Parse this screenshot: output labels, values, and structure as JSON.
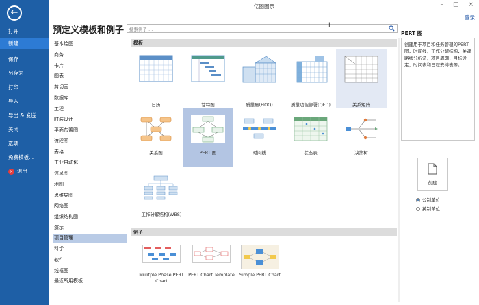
{
  "window": {
    "title": "亿图图示",
    "login": "登录"
  },
  "sidebar": {
    "items": [
      "打开",
      "新建",
      "保存",
      "另存为",
      "打印",
      "导入",
      "导出 & 发送",
      "关闭",
      "选项",
      "免费模板...",
      "退出"
    ]
  },
  "main": {
    "heading": "预定义模板和例子",
    "search_placeholder": "搜索例子 . . ."
  },
  "categories": [
    "基本绘图",
    "商务",
    "卡片",
    "图表",
    "剪切画",
    "数据库",
    "工程",
    "时装设计",
    "平面布置图",
    "流程图",
    "表格",
    "工业自动化",
    "信息图",
    "地图",
    "思维导图",
    "网络图",
    "组织结构图",
    "演示",
    "项目管理",
    "科学",
    "软件",
    "线框图",
    "最近所用模板"
  ],
  "templates": {
    "section": "模板",
    "items": [
      "日历",
      "甘特图",
      "质量屋(HOQ)",
      "质量功能部署(QFD)",
      "关系矩阵",
      "关系图",
      "PERT 图",
      "时间线",
      "状态表",
      "决策树",
      "工作分解结构(WBS)"
    ]
  },
  "examples": {
    "section": "例子",
    "items": [
      "Mulitple Phase PERT Chart",
      "PERT Chart Template",
      "Simple PERT Chart"
    ]
  },
  "right_panel": {
    "title": "PERT 图",
    "description": "创建用于项目和任务管理的PERT图，时间线，工作分解结构，关键路线分析法，项目周期，目标设定，时间表和日程安排表等。",
    "create_label": "创建",
    "units": [
      "公制单位",
      "英制单位"
    ]
  },
  "colors": {
    "sidebar": "#1e5fa6",
    "selected": "#b3c5e3"
  }
}
